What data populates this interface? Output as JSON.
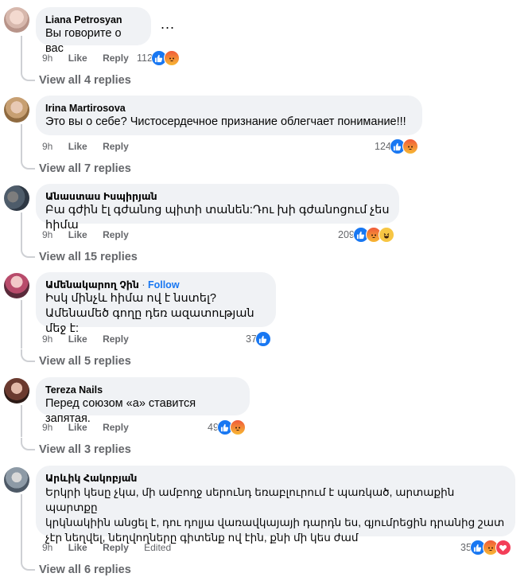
{
  "comments": [
    {
      "author": "Liana Petrosyan",
      "text": "Вы говорите о вас",
      "time": "9h",
      "like": "Like",
      "reply": "Reply",
      "reaction_count": "112",
      "reactions": [
        "like",
        "angry"
      ],
      "view_replies": "View all 4 replies",
      "more": "..."
    },
    {
      "author": "Irina Martirosova",
      "text": "Это вы о себе? Чистосердечное признание облегчает понимание!!!",
      "time": "9h",
      "like": "Like",
      "reply": "Reply",
      "reaction_count": "124",
      "reactions": [
        "like",
        "angry"
      ],
      "view_replies": "View all 7 replies"
    },
    {
      "author": "Անաստաս Իսպիրյան",
      "text": "Բա գժին էլ գժանոց պիտի տանեն:Դու խի գժանոցում չես հիմա",
      "time": "9h",
      "like": "Like",
      "reply": "Reply",
      "reaction_count": "209",
      "reactions": [
        "like",
        "angry",
        "haha"
      ],
      "view_replies": "View all 15 replies"
    },
    {
      "author": "Ամենակարող Չին",
      "dot": " · ",
      "follow": "Follow",
      "text": "Իսկ մինչև հիմա ով է նստել?\nԱմենամեծ գողը դեռ ազատության մեջ է:",
      "time": "9h",
      "like": "Like",
      "reply": "Reply",
      "reaction_count": "37",
      "reactions": [
        "like"
      ],
      "view_replies": "View all 5 replies"
    },
    {
      "author": "Tereza Nails",
      "text": "Перед союзом «а» ставится запятая.",
      "time": "9h",
      "like": "Like",
      "reply": "Reply",
      "reaction_count": "49",
      "reactions": [
        "like",
        "angry"
      ],
      "view_replies": "View all 3 replies"
    },
    {
      "author": "Արևիկ Հակոբյան",
      "text": "Երկրի կեսը չկա, մի ամբողջ սերունդ եռաբլուրում է պառկած, արտաքին պարտքը\nկրկնակիին անցել է, դու դոլյա վառավկայայի դարդն ես, գյումրեցին դրանից շատ\nչէր նեղվել, նեղվողները գիտենք ով էին, քնի մի կես ժամ",
      "time": "9h",
      "like": "Like",
      "reply": "Reply",
      "edited": "Edited",
      "reaction_count": "35",
      "reactions": [
        "like",
        "angry",
        "love"
      ],
      "view_replies": "View all 6 replies"
    }
  ],
  "colors": {
    "accent": "#1877f2",
    "bubble": "#f0f2f5",
    "muted": "#65676b"
  }
}
